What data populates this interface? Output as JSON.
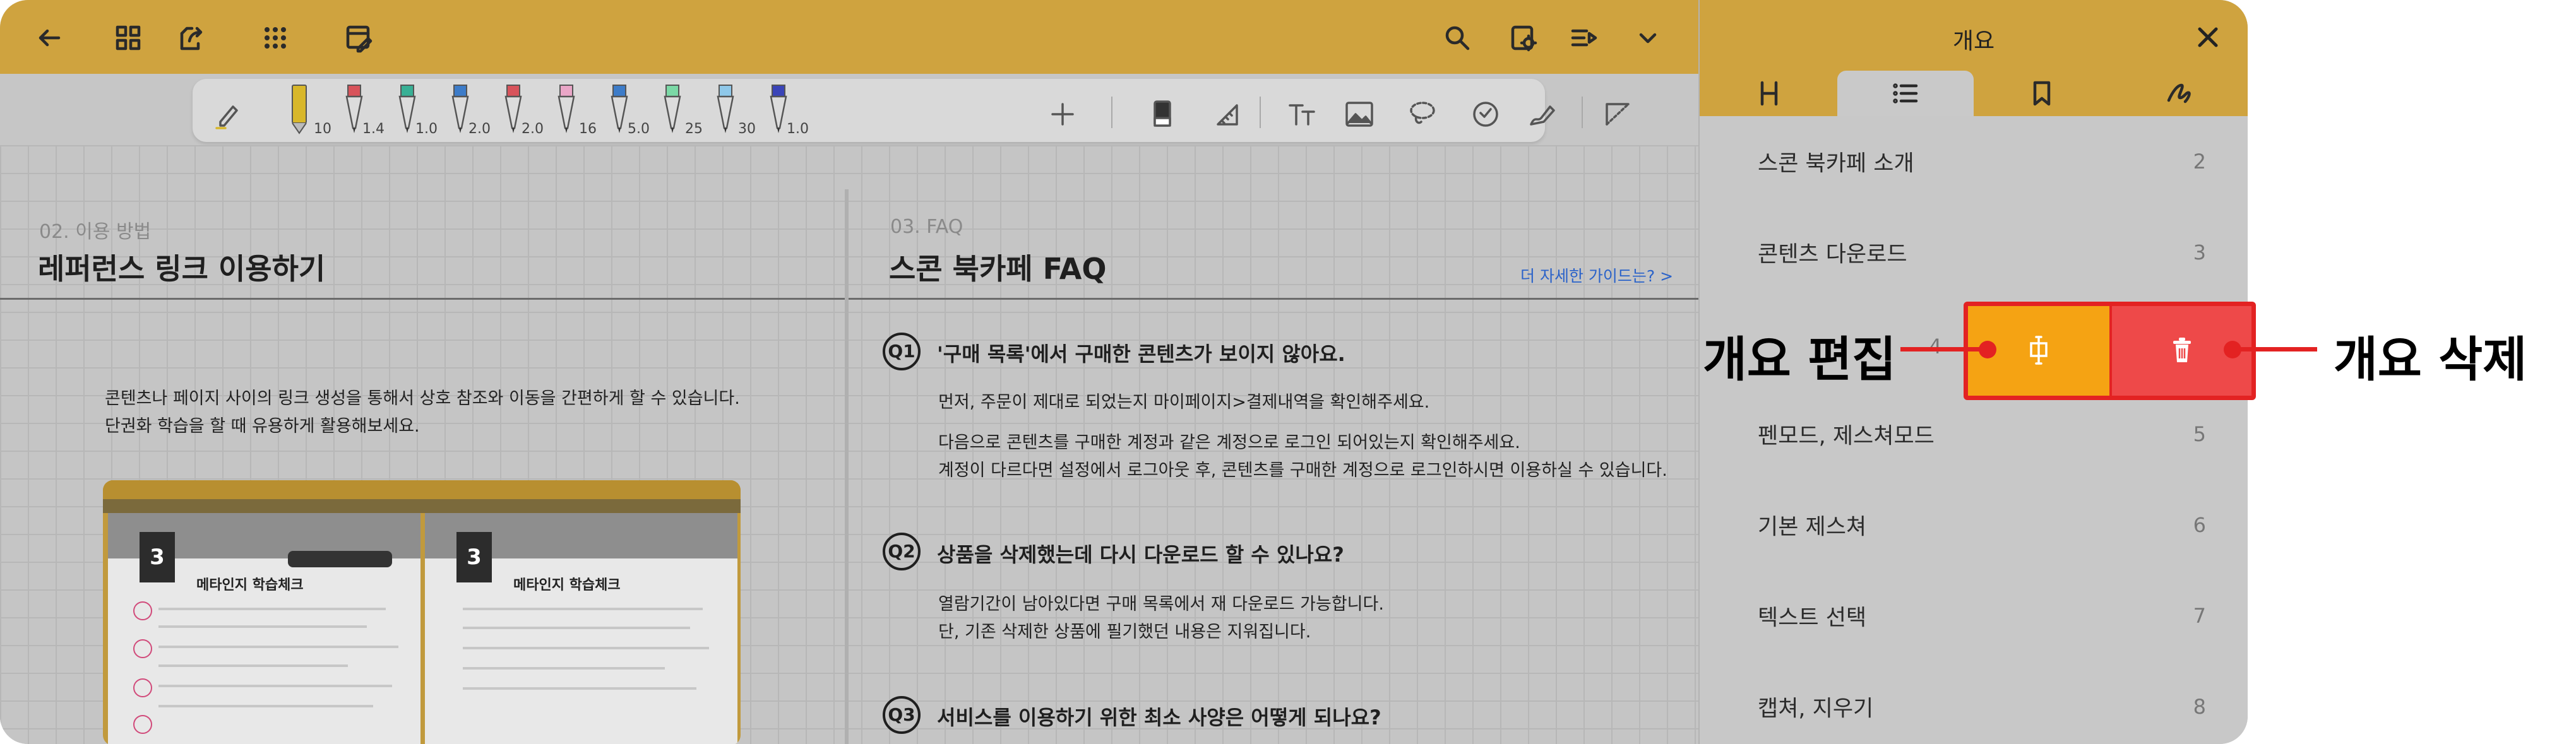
{
  "topbar": {
    "left_icons": [
      "back-arrow-icon",
      "grid-view-icon",
      "page-export-icon",
      "apps-icon",
      "layout-edit-icon"
    ],
    "right_icons": [
      "search-icon",
      "settings-icon",
      "list-play-icon",
      "chevron-down-icon"
    ]
  },
  "toolbar": {
    "pens": [
      {
        "name": "highlighter-gold",
        "size": "10",
        "color": "#d8b72a"
      },
      {
        "name": "pen-red",
        "size": "1.4",
        "color": "#d8535b"
      },
      {
        "name": "pen-teal",
        "size": "1.0",
        "color": "#38b095"
      },
      {
        "name": "pen-blue",
        "size": "2.0",
        "color": "#3d7cc9"
      },
      {
        "name": "pen-red-2",
        "size": "2.0",
        "color": "#d8535b"
      },
      {
        "name": "marker-pink",
        "size": "16",
        "color": "#eaa6c7"
      },
      {
        "name": "pen-blue-2",
        "size": "5.0",
        "color": "#3d7cc9"
      },
      {
        "name": "marker-green",
        "size": "25",
        "color": "#7bd9a6"
      },
      {
        "name": "marker-skyblue",
        "size": "30",
        "color": "#8fc8e9"
      },
      {
        "name": "pen-navy",
        "size": "1.0",
        "color": "#3a44b8"
      }
    ],
    "tools": [
      "add-icon",
      "eraser-icon",
      "ruler-icon",
      "text-icon",
      "image-icon",
      "lasso-icon",
      "sticker-icon",
      "shape-pen-icon",
      "crop-icon"
    ]
  },
  "left_page": {
    "section_num": "02. 이용 방법",
    "title": "레퍼런스 링크 이용하기",
    "paragraph_1": "콘텐츠나 페이지 사이의 링크 생성을 통해서 상호 참조와 이동을 간편하게 할 수 있습니다.",
    "paragraph_2": "단권화 학습을 할 때 유용하게 활용해보세요.",
    "preview": {
      "chapter": "3",
      "title_left": "메타인지 학습체크",
      "title_right": "메타인지 학습체크"
    }
  },
  "right_page": {
    "section_num": "03. FAQ",
    "title": "스콘 북카페 FAQ",
    "guide_link": "더 자세한 가이드는? >",
    "faqs": [
      {
        "badge": "Q1",
        "question": "'구매 목록'에서 구매한 콘텐츠가 보이지 않아요.",
        "answer_1": "먼저, 주문이 제대로 되었는지 마이페이지>결제내역을 확인해주세요.",
        "answer_2": "다음으로 콘텐츠를 구매한 계정과 같은 계정으로 로그인 되어있는지 확인해주세요.",
        "answer_3": "계정이 다르다면 설정에서 로그아웃 후, 콘텐츠를 구매한 계정으로 로그인하시면 이용하실 수 있습니다."
      },
      {
        "badge": "Q2",
        "question": "상품을 삭제했는데 다시 다운로드 할 수 있나요?",
        "answer_1": "열람기간이 남아있다면 구매 목록에서 재 다운로드 가능합니다.",
        "answer_2": "단, 기존 삭제한 상품에 필기했던 내용은 지워집니다."
      },
      {
        "badge": "Q3",
        "question": "서비스를 이용하기 위한 최소 사양은 어떻게 되나요?"
      }
    ]
  },
  "panel": {
    "title": "개요",
    "tabs": [
      {
        "name": "tab-hierarchy",
        "icon": "hierarchy-icon"
      },
      {
        "name": "tab-outline",
        "icon": "list-icon",
        "active": true
      },
      {
        "name": "tab-bookmark",
        "icon": "bookmark-icon"
      },
      {
        "name": "tab-handwriting",
        "icon": "handwriting-icon"
      }
    ],
    "outline": [
      {
        "label": "스콘 북카페 소개",
        "page": "2"
      },
      {
        "label": "콘텐츠 다운로드",
        "page": "3"
      },
      {
        "label": "",
        "page": "4"
      },
      {
        "label": "펜모드, 제스쳐모드",
        "page": "5"
      },
      {
        "label": "기본 제스쳐",
        "page": "6"
      },
      {
        "label": "텍스트 선택",
        "page": "7"
      },
      {
        "label": "캡쳐, 지우기",
        "page": "8"
      }
    ],
    "swipe_actions": {
      "edit_icon": "edit-outline-icon",
      "delete_icon": "trash-icon",
      "edit_color": "#f5a313",
      "delete_color": "#ee4949"
    }
  },
  "callouts": {
    "edit": "개요 편집",
    "delete": "개요 삭제",
    "color": "#e32222"
  }
}
